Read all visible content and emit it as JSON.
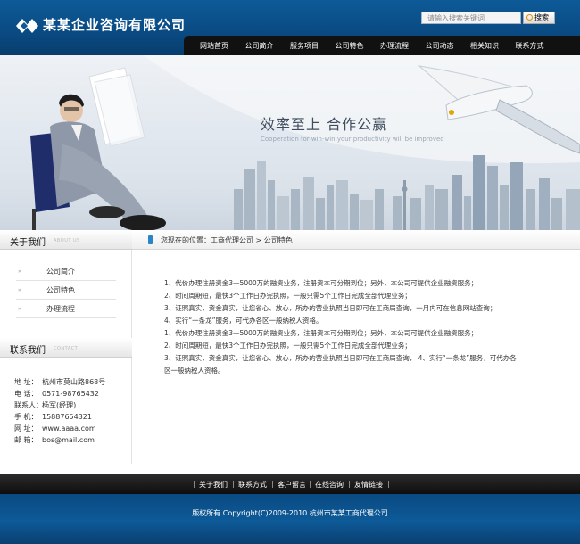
{
  "header": {
    "company_name": "某某企业咨询有限公司",
    "search_placeholder": "请输入搜索关键词",
    "search_button": "搜索"
  },
  "nav": {
    "items": [
      "网站首页",
      "公司简介",
      "服务项目",
      "公司特色",
      "办理流程",
      "公司动态",
      "相关知识",
      "联系方式"
    ]
  },
  "banner": {
    "title": "效率至上  合作公赢",
    "subtitle": "Cooperation for win-win,your productivity will be improved"
  },
  "sidebar": {
    "about": {
      "title": "关于我们",
      "title_en": "ABOUT US",
      "items": [
        "公司简介",
        "公司特色",
        "办理流程"
      ]
    },
    "contact": {
      "title": "联系我们",
      "title_en": "CONTACT",
      "rows": [
        {
          "key": "地  址：",
          "value": "杭州市莫山路868号"
        },
        {
          "key": "电  话：",
          "value": "0571-98765432"
        },
        {
          "key": "联系人：",
          "value": "杨军(经理)"
        },
        {
          "key": "手  机：",
          "value": "15887654321"
        },
        {
          "key": "网  址：",
          "value": "www.aaaa.com"
        },
        {
          "key": "邮  箱：",
          "value": "bos@mail.com"
        }
      ]
    }
  },
  "content": {
    "breadcrumb": "您现在的位置：工商代理公司 > 公司特色",
    "lines": [
      "1、代价办理注册资金3—5000万的融资业务，注册资本可分期到位；另外，本公司可提供企业融资服务；",
      "2、时间周期短，最快3个工作日办完执照，一般只需5个工作日完成全部代理业务；",
      "3、证照真实，资金真实，让您省心、放心，所办的营业执照当日即可在工商局查询，一月内可在信息网站查询；",
      "4、实行“一条龙”服务，可代办各区一般纳税人资格。",
      "1、代价办理注册资金3—5000万的融资业务，注册资本可分期到位；另外，本公司可提供企业融资服务；",
      "2、时间周期短，最快3个工作日办完执照，一般只需5个工作日完成全部代理业务；",
      "3、证照真实，资金真实，让您省心、放心，所办的营业执照当日即可在工商局查询，  4、实行“一条龙”服务，可代办各",
      "区一般纳税人资格。"
    ]
  },
  "footer": {
    "links": [
      "关于我们",
      "联系方式",
      "客户留言",
      "在线咨询",
      "友情链接"
    ],
    "copyright": "版权所有  Copyright(C)2009-2010 杭州市某某工商代理公司"
  }
}
